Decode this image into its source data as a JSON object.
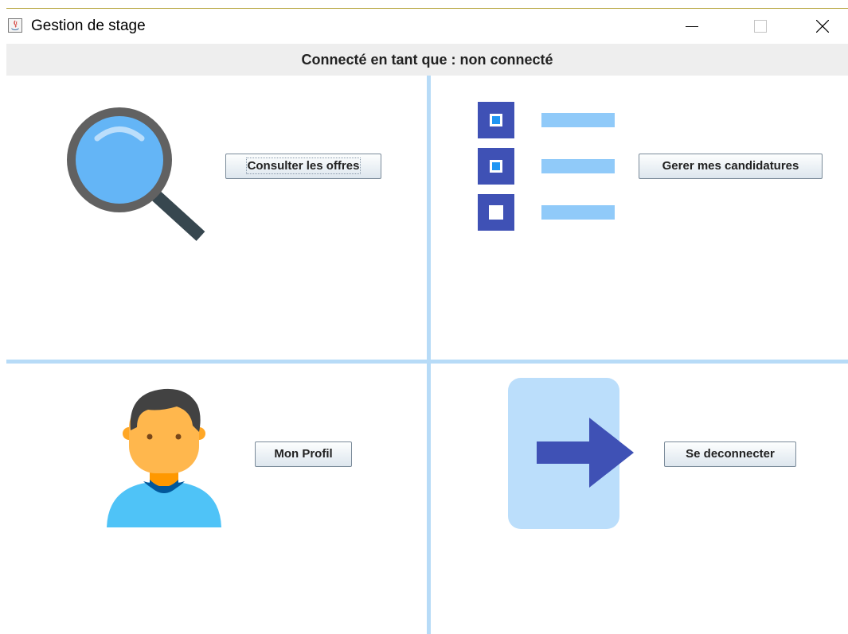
{
  "window": {
    "title": "Gestion de stage",
    "controls": {
      "minimize": "minimize",
      "maximize": "maximize",
      "close": "close"
    }
  },
  "status": {
    "text": "Connecté en tant que : non connecté"
  },
  "panels": {
    "offers": {
      "button_label": "Consulter les offres",
      "icon": "magnifier-icon"
    },
    "applications": {
      "button_label": "Gerer mes candidatures",
      "icon": "checklist-icon"
    },
    "profile": {
      "button_label": "Mon Profil",
      "icon": "user-avatar-icon"
    },
    "logout": {
      "button_label": "Se deconnecter",
      "icon": "logout-arrow-icon"
    }
  },
  "colors": {
    "divider": "#b7dbf7",
    "status_bar_bg": "#eeeeee",
    "accent_blue": "#3f51b5",
    "light_blue": "#90caf9"
  }
}
